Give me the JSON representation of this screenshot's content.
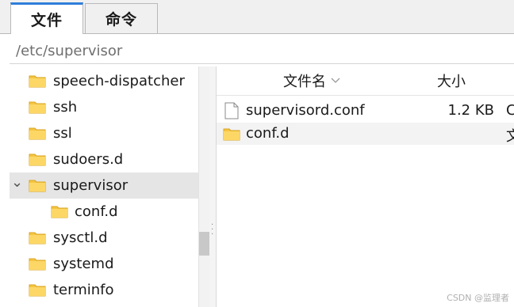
{
  "tabs": {
    "files": "文件",
    "commands": "命令"
  },
  "path": "/etc/supervisor",
  "tree": {
    "items": [
      {
        "label": "speech-dispatcher"
      },
      {
        "label": "ssh"
      },
      {
        "label": "ssl"
      },
      {
        "label": "sudoers.d"
      },
      {
        "label": "supervisor",
        "expanded": true,
        "selected": true
      },
      {
        "label": "conf.d",
        "child": true
      },
      {
        "label": "sysctl.d"
      },
      {
        "label": "systemd"
      },
      {
        "label": "terminfo"
      }
    ],
    "expand_chevron": "⌄"
  },
  "file_list": {
    "columns": {
      "name": "文件名",
      "size": "大小",
      "extra": ""
    },
    "sort_icon": "chevron-down-icon",
    "rows": [
      {
        "name": "supervisord.conf",
        "size": "1.2 KB",
        "type": "C",
        "icon": "file-icon"
      },
      {
        "name": "conf.d",
        "size": "",
        "type": "文",
        "icon": "folder-icon"
      }
    ]
  },
  "watermark": "CSDN @监理者",
  "colors": {
    "accent": "#2f7fd9",
    "folder": "#f5c542",
    "selected": "#e5e5e5"
  }
}
